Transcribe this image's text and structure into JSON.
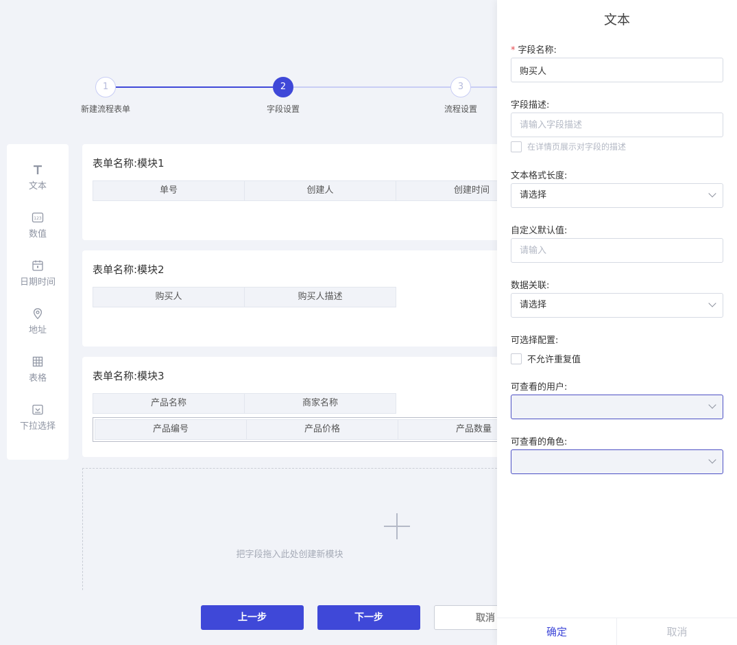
{
  "steps": [
    {
      "number": "1",
      "label": "新建流程表单"
    },
    {
      "number": "2",
      "label": "字段设置"
    },
    {
      "number": "3",
      "label": "流程设置"
    }
  ],
  "palette": [
    {
      "label": "文本",
      "icon": "text-icon"
    },
    {
      "label": "数值",
      "icon": "number-icon"
    },
    {
      "label": "日期时间",
      "icon": "calendar-icon"
    },
    {
      "label": "地址",
      "icon": "location-icon"
    },
    {
      "label": "表格",
      "icon": "table-icon"
    },
    {
      "label": "下拉选择",
      "icon": "dropdown-icon"
    }
  ],
  "modules": [
    {
      "title": "表单名称:模块1",
      "rows": [
        [
          "单号",
          "创建人",
          "创建时间"
        ]
      ]
    },
    {
      "title": "表单名称:模块2",
      "rows": [
        [
          "购买人",
          "购买人描述"
        ]
      ]
    },
    {
      "title": "表单名称:模块3",
      "rows": [
        [
          "产品名称",
          "商家名称"
        ],
        [
          "产品编号",
          "产品价格",
          "产品数量"
        ]
      ]
    }
  ],
  "dropzone": {
    "text": "把字段拖入此处创建新模块"
  },
  "buttons": {
    "prev": "上一步",
    "next": "下一步",
    "cancel": "取消"
  },
  "panel": {
    "title": "文本",
    "field_name": {
      "required_mark": "*",
      "label": "字段名称:",
      "value": "购买人"
    },
    "field_desc": {
      "label": "字段描述:",
      "placeholder": "请输入字段描述",
      "checkbox_label": "在详情页展示对字段的描述"
    },
    "text_length": {
      "label": "文本格式长度:",
      "value": "请选择"
    },
    "default_value": {
      "label": "自定义默认值:",
      "placeholder": "请输入"
    },
    "data_link": {
      "label": "数据关联:",
      "value": "请选择"
    },
    "option_config": {
      "label": "可选择配置:",
      "checkbox_label": "不允许重复值"
    },
    "visible_users": {
      "label": "可查看的用户:"
    },
    "visible_roles": {
      "label": "可查看的角色:"
    },
    "footer": {
      "confirm": "确定",
      "cancel": "取消"
    }
  },
  "colors": {
    "accent": "#3f48d8",
    "background": "#f1f3f8",
    "required": "#e5484d"
  }
}
